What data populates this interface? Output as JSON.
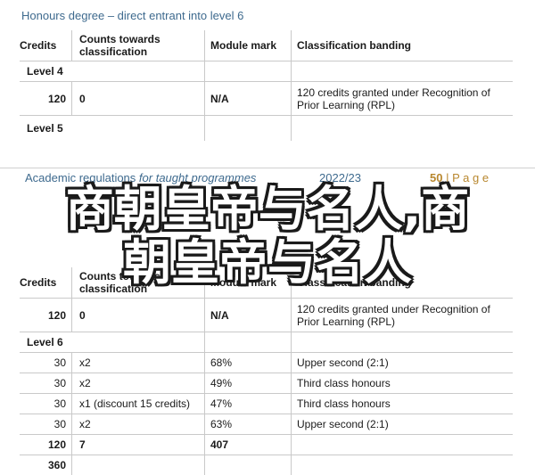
{
  "page1": {
    "title": "Honours degree – direct entrant into level 6",
    "headers": {
      "credits": "Credits",
      "counts": "Counts towards classification",
      "mark": "Module mark",
      "classification": "Classification banding"
    },
    "level4_label": "Level 4",
    "row_120": {
      "credits": "120",
      "counts": "0",
      "mark": "N/A",
      "classification": "120 credits granted under Recognition of Prior Learning (RPL)"
    },
    "level5_label": "Level 5"
  },
  "running_header": {
    "title": "Academic regulations",
    "subtitle": "for taught programmes",
    "year": "2022/23",
    "page_number": "50",
    "page_word": "| P a g e"
  },
  "overlay": {
    "line1": "商朝皇帝与名人,商",
    "line2": "朝皇帝与名人"
  },
  "page2": {
    "headers": {
      "credits": "Credits",
      "counts": "Counts towards classification",
      "mark": "Module mark",
      "classification": "Classification banding"
    },
    "row_120": {
      "credits": "120",
      "counts": "0",
      "mark": "N/A",
      "classification": "120 credits granted under Recognition of Prior Learning (RPL)"
    },
    "level6_label": "Level 6",
    "rows": [
      {
        "credits": "30",
        "counts": "x2",
        "mark": "68%",
        "classification": "Upper second (2:1)"
      },
      {
        "credits": "30",
        "counts": "x2",
        "mark": "49%",
        "classification": "Third class honours"
      },
      {
        "credits": "30",
        "counts": "x1 (discount 15 credits)",
        "mark": "47%",
        "classification": "Third class honours"
      },
      {
        "credits": "30",
        "counts": "x2",
        "mark": "63%",
        "classification": "Upper second (2:1)"
      }
    ],
    "total": {
      "credits": "120",
      "counts": "7",
      "mark": "407"
    },
    "grand_total": {
      "credits": "360"
    }
  }
}
